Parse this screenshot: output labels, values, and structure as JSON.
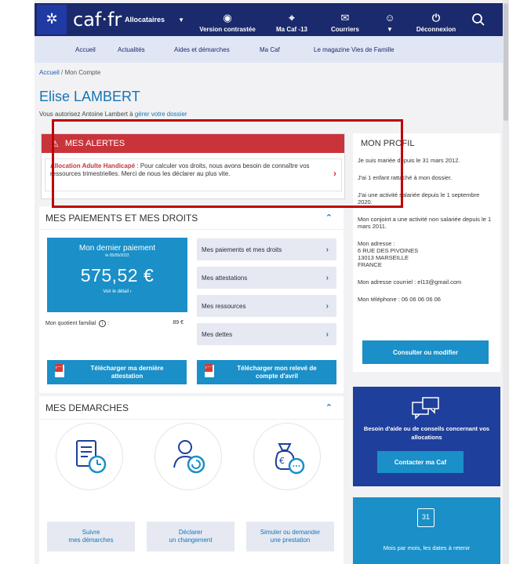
{
  "topbar": {
    "brand": "caf·fr",
    "allocataires": "Allocataires",
    "version_contrastee": "Version contrastée",
    "ma_caf": "Ma Caf -13",
    "courriers": "Courriers",
    "deconnexion": "Déconnexion"
  },
  "subnav": {
    "accueil": "Accueil",
    "actualites": "Actualités",
    "aides": "Aides et démarches",
    "ma_caf": "Ma Caf",
    "magazine": "Le magazine Vies de Famille"
  },
  "breadcrumb": {
    "home": "Accueil",
    "separator": " / ",
    "current": "Mon Compte"
  },
  "user": {
    "name": "Elise LAMBERT",
    "auth_prefix": "Vous autorisez Antoine Lambert à ",
    "auth_link": "gérer votre dossier"
  },
  "alerts": {
    "title": "MES ALERTES",
    "item_tag": "Allocation Adulte Handicapé",
    "item_text": " : Pour calculer vos droits, nous avons besoin de connaître vos ressources trimestrielles. Merci de nous les déclarer au plus vite."
  },
  "payments": {
    "title": "MES PAIEMENTS ET MES DROITS",
    "last_payment_label": "Mon dernier paiement",
    "last_payment_date": "le 05/05/2022",
    "amount": "575,52 €",
    "detail": "Voir le détail",
    "quotient_label": "Mon quotient familial",
    "quotient_value": "89 €",
    "links": [
      "Mes paiements et mes droits",
      "Mes attestations",
      "Mes ressources",
      "Mes dettes"
    ],
    "download_attestation": "Télécharger ma dernière attestation",
    "download_releve": "Télécharger mon relevé de compte d'avril"
  },
  "demarches": {
    "title": "MES DEMARCHES",
    "links": [
      {
        "line1": "Suivre",
        "line2": "mes démarches"
      },
      {
        "line1": "Déclarer",
        "line2": "un changement"
      },
      {
        "line1": "Simuler ou demander",
        "line2": "une prestation"
      }
    ]
  },
  "profile": {
    "title": "MON PROFIL",
    "items": [
      "Je suis mariée depuis le 31 mars 2012.",
      "J'ai 1 enfant rattaché à mon dossier.",
      "J'ai une activité salariée depuis le 1 septembre 2020.",
      "Mon conjoint a une activité non salariée depuis le 1 mars 2011."
    ],
    "address_label": "Mon adresse :",
    "address_lines": [
      "6 RUE DES PIVOINES",
      "13013 MARSEILLE",
      "FRANCE"
    ],
    "email": "Mon adresse courriel : el13@gmail.com",
    "phone": "Mon téléphone : 06 06 06 06 06",
    "button": "Consulter ou modifier"
  },
  "help": {
    "text": "Besoin d'aide ou de conseils concernant vos allocations",
    "button": "Contacter ma Caf"
  },
  "months": {
    "calendar_day": "31",
    "text": "Mois par mois, les dates à retenir"
  },
  "colors": {
    "nav_dark": "#1a2a6c",
    "accent_blue": "#1a8fc8",
    "alert_red": "#c9343b",
    "highlight_red": "#c00000",
    "help_blue": "#1f3f9c"
  }
}
